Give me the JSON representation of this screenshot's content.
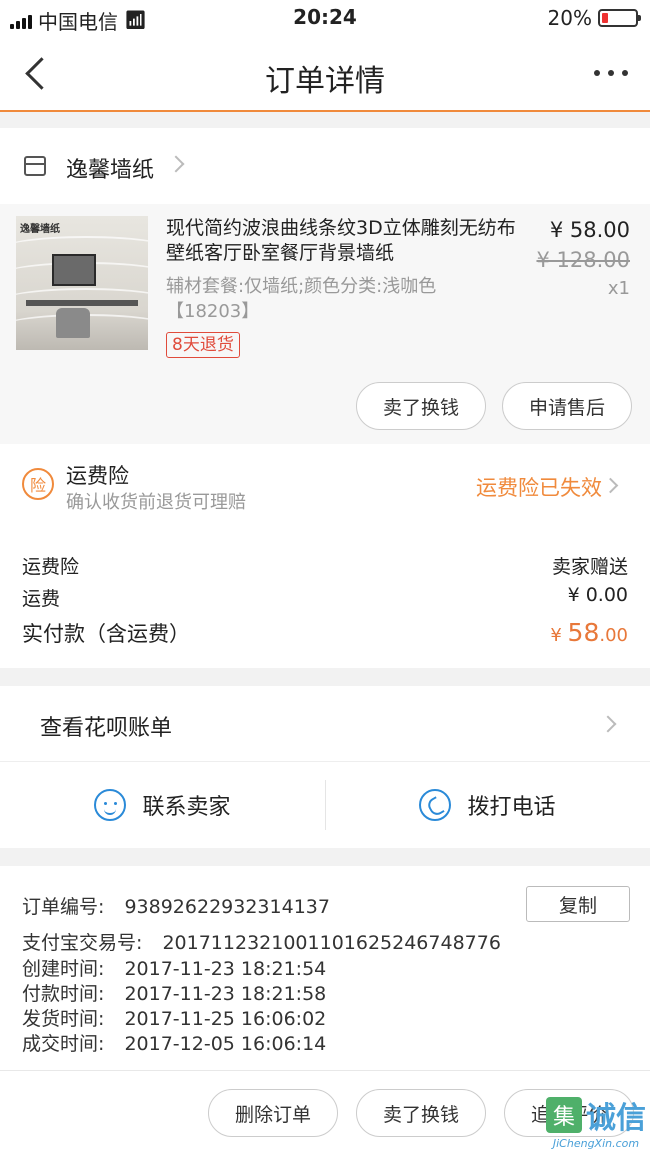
{
  "status_bar": {
    "carrier": "中国电信",
    "time": "20:24",
    "battery_percent": "20%",
    "battery_level": 0.2
  },
  "nav": {
    "title": "订单详情"
  },
  "shop": {
    "name": "逸馨墙纸"
  },
  "product": {
    "thumb_logo": "逸馨墙纸",
    "title": "现代简约波浪曲线条纹3D立体雕刻无纺布壁纸客厅卧室餐厅背景墙纸",
    "spec": "辅材套餐:仅墙纸;颜色分类:浅咖色【18203】",
    "badge": "8天退货",
    "price": "¥ 58.00",
    "original_price": "¥ 128.00",
    "quantity": "x1",
    "sell_button": "卖了换钱",
    "after_sale_button": "申请售后"
  },
  "insurance": {
    "icon_label": "险",
    "title": "运费险",
    "subtitle": "确认收货前退货可理赔",
    "status": "运费险已失效"
  },
  "fees": {
    "insurance_label": "运费险",
    "insurance_value": "卖家赠送",
    "shipping_label": "运费",
    "shipping_value": "¥ 0.00",
    "total_label": "实付款（含运费）",
    "total_currency": "¥ ",
    "total_int": "58",
    "total_dec": ".00"
  },
  "huabei": {
    "label": "查看花呗账单"
  },
  "contact": {
    "seller": "联系卖家",
    "phone": "拨打电话"
  },
  "order_info": {
    "order_no_label": "订单编号:",
    "order_no": "93892622932314137",
    "copy_button": "复制",
    "alipay_label": "支付宝交易号:",
    "alipay_no": "2017112321001101625246748776",
    "created_label": "创建时间:",
    "created": "2017-11-23 18:21:54",
    "paid_label": "付款时间:",
    "paid": "2017-11-23 18:21:58",
    "shipped_label": "发货时间:",
    "shipped": "2017-11-25 16:06:02",
    "completed_label": "成交时间:",
    "completed": "2017-12-05 16:06:14"
  },
  "footer": {
    "delete_button": "删除订单",
    "sell_button": "卖了换钱",
    "review_button": "追加评价"
  },
  "watermark": {
    "box": "集",
    "text": "诚信",
    "url": "JiChengXin.com"
  },
  "colors": {
    "accent": "#f08a3c",
    "price_red": "#e04b3b",
    "link_blue": "#2a8ad8"
  }
}
